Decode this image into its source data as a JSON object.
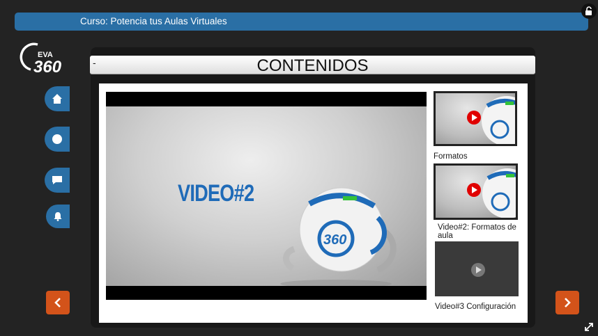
{
  "course_bar": {
    "title": "Curso: Potencia tus Aulas Virtuales"
  },
  "logo": {
    "top_text": "EVA",
    "main_text": "360"
  },
  "sidebar": {
    "items": [
      {
        "icon": "home-icon"
      },
      {
        "icon": "circle-icon"
      },
      {
        "icon": "chat-icon"
      },
      {
        "icon": "bell-icon"
      }
    ]
  },
  "panel": {
    "minimize_label": "-",
    "heading": "CONTENIDOS"
  },
  "player": {
    "overlay_text": "VIDEO#2",
    "robot_badge": "360"
  },
  "playlist": [
    {
      "caption": "Formatos"
    },
    {
      "caption": "Video#2: Formatos de aula"
    },
    {
      "caption": "Video#3 Configuración"
    }
  ],
  "colors": {
    "brand_blue": "#2a6fa5",
    "nav_orange": "#d3531a",
    "play_red": "#e00000",
    "background": "#232323"
  }
}
